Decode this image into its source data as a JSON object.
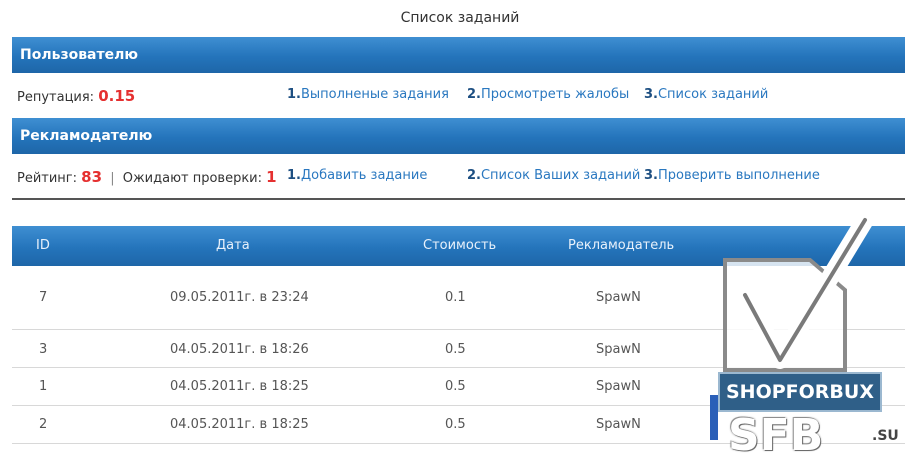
{
  "page_title": "Список заданий",
  "user_section": {
    "header": "Пользователю",
    "reputation_label": "Репутация:",
    "reputation_value": "0.15",
    "links": [
      {
        "index": "1.",
        "label": "Выполненые задания"
      },
      {
        "index": "2.",
        "label": "Просмотреть жалобы"
      },
      {
        "index": "3.",
        "label": "Список заданий"
      }
    ]
  },
  "advertiser_section": {
    "header": "Рекламодателю",
    "rating_label": "Рейтинг:",
    "rating_value": "83",
    "separator": "|",
    "pending_label": "Ожидают проверки:",
    "pending_value": "1",
    "links": [
      {
        "index": "1.",
        "label": "Добавить задание"
      },
      {
        "index": "2.",
        "label": "Список Ваших заданий"
      },
      {
        "index": "3.",
        "label": "Проверить выполнение"
      }
    ]
  },
  "table": {
    "columns": [
      "ID",
      "Дата",
      "Стоимость",
      "Рекламодатель"
    ],
    "rows": [
      {
        "id": "7",
        "date": "09.05.2011г. в 23:24",
        "cost": "0.1",
        "advertiser": "SpawN"
      },
      {
        "id": "3",
        "date": "04.05.2011г. в 18:26",
        "cost": "0.5",
        "advertiser": "SpawN"
      },
      {
        "id": "1",
        "date": "04.05.2011г. в 18:25",
        "cost": "0.5",
        "advertiser": "SpawN"
      },
      {
        "id": "2",
        "date": "04.05.2011г. в 18:25",
        "cost": "0.5",
        "advertiser": "SpawN"
      }
    ]
  },
  "watermark": {
    "brand": "SHOPFORBUX",
    "site": "SFB",
    "tld": ".SU"
  },
  "colors": {
    "header_blue": "#2474bb",
    "link_blue": "#2a78c0",
    "value_red": "#e53030"
  }
}
